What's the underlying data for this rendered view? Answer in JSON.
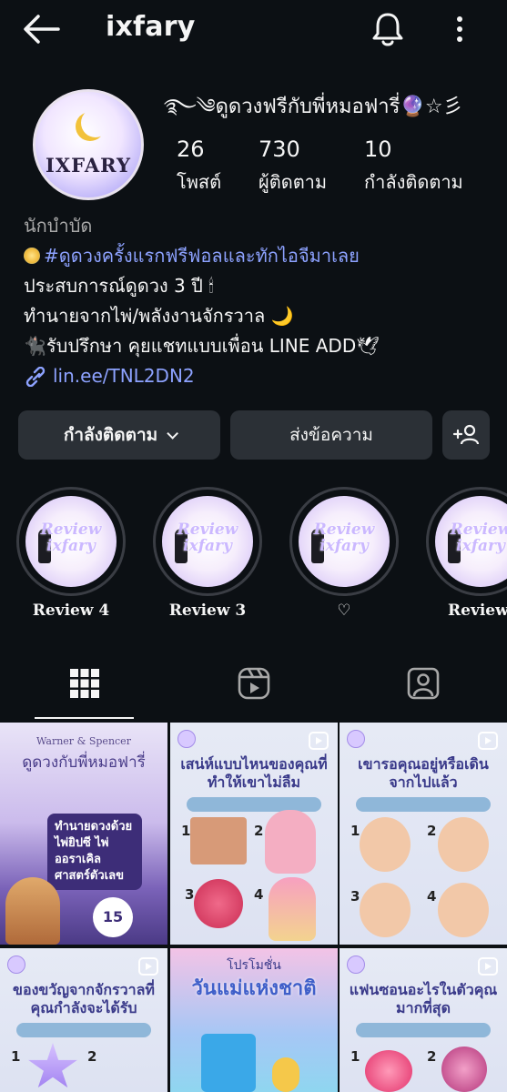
{
  "header": {
    "username": "ixfary"
  },
  "profile": {
    "avatar_text": "IXFARY",
    "display_name": "࿐༄ดูดวงฟรีกับพี่หมอฟารี่🔮☆彡",
    "stats": [
      {
        "value": "26",
        "label": "โพสต์"
      },
      {
        "value": "730",
        "label": "ผู้ติดตาม"
      },
      {
        "value": "10",
        "label": "กำลังติดตาม"
      }
    ],
    "category": "นักบำบัด",
    "bio_hashtag": "#ดูดวงครั้งแรกฟรีฟอลและทักไอจีมาเลย",
    "bio_lines": [
      "ประสบการณ์ดูดวง 3 ปี 🕯",
      "ทำนายจากไพ่/พลังงานจักรวาล 🌙",
      "🐈‍⬛รับปรึกษา คุยแชทแบบเพื่อน LINE ADD🕊"
    ],
    "link": "lin.ee/TNL2DN2"
  },
  "actions": {
    "following_label": "กำลังติดตาม",
    "message_label": "ส่งข้อความ"
  },
  "highlights": [
    {
      "label": "Review 4",
      "cover": "Review ixfary"
    },
    {
      "label": "Review 3",
      "cover": "Review ixfary"
    },
    {
      "label": "♡",
      "cover": "Review ixfary"
    },
    {
      "label": "Review",
      "cover": "Review ixfary"
    }
  ],
  "posts": [
    {
      "title": "ดูดวงกับพี่หมอฟารี่",
      "caption": "ทำนายดวงด้วย ไพ่ยิปซี ไพ่ออราเคิล ศาสตร์ตัวเลข",
      "badge": "15",
      "brand": "Warner & Spencer",
      "reel": false
    },
    {
      "title": "เสน่ห์แบบไหนของคุณที่ทำให้เขาไม่ลืม",
      "reel": true
    },
    {
      "title": "เขารอคุณอยู่หรือเดินจากไปแล้ว",
      "reel": true
    },
    {
      "title": "ของขวัญจากจักรวาลที่คุณกำลังจะได้รับ",
      "reel": true
    },
    {
      "title": "วันแม่แห่งชาติ",
      "subtitle": "โปรโมชั่น",
      "reel": false
    },
    {
      "title": "แฟนซอนอะไรในตัวคุณมากที่สุด",
      "reel": true
    }
  ],
  "colors": {
    "background": "#0c1014",
    "link": "#8da2ff",
    "button": "#2b3036",
    "muted": "#a8a8a8"
  }
}
